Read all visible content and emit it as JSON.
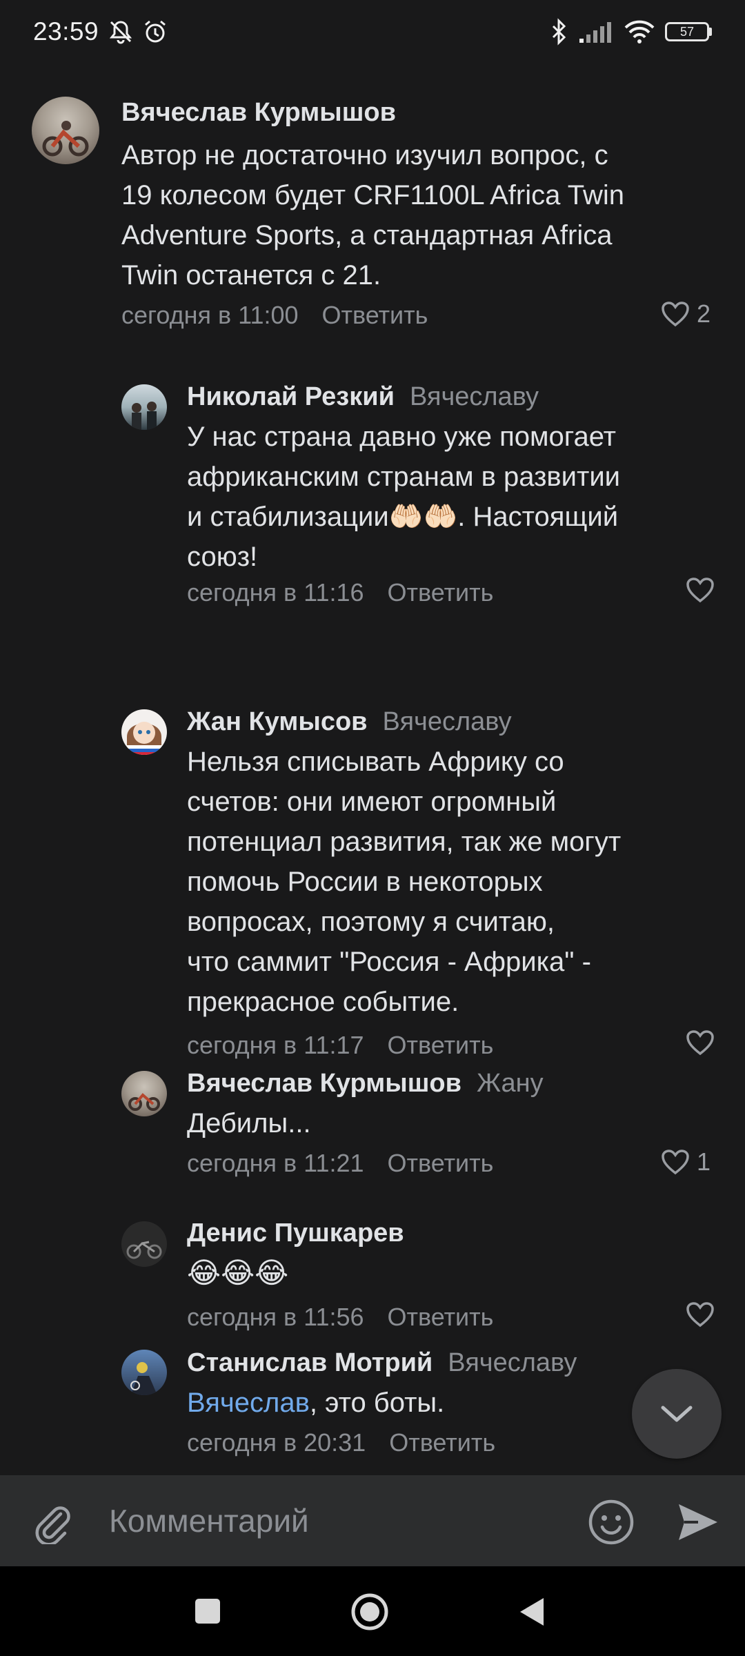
{
  "status_bar": {
    "time": "23:59",
    "battery": "57",
    "icons": [
      "mute-icon",
      "alarm-icon",
      "bluetooth-icon",
      "signal-icon",
      "wifi-icon",
      "battery-icon"
    ]
  },
  "comments": [
    {
      "author": "Вячеслав Курмышов",
      "reply_to": "",
      "text_lines": [
        "Автор не достаточно изучил вопрос, с",
        "19 колесом будет CRF1100L Africa Twin",
        "Adventure Sports, а стандартная Africa",
        "Twin останется с 21."
      ],
      "time": "сегодня в 11:00",
      "reply_label": "Ответить",
      "likes": "2"
    },
    {
      "author": "Николай Резкий",
      "reply_to": "Вячеславу",
      "text_lines": [
        "У нас страна давно уже помогает",
        "африканским странам в развитии",
        "и стабилизации🤲🏻🤲🏻. Настоящий",
        "союз!"
      ],
      "time": "сегодня в 11:16",
      "reply_label": "Ответить",
      "likes": ""
    },
    {
      "author": "Жан Кумысов",
      "reply_to": "Вячеславу",
      "text_lines": [
        "Нельзя списывать Африку со",
        "счетов: они имеют огромный",
        "потенциал развития, так же могут",
        "помочь России в некоторых",
        "вопросах, поэтому я считаю,",
        "что саммит \"Россия - Африка\" -",
        "прекрасное событие."
      ],
      "time": "сегодня в 11:17",
      "reply_label": "Ответить",
      "likes": ""
    },
    {
      "author": "Вячеслав Курмышов",
      "reply_to": "Жану",
      "text_lines": [
        "Дебилы..."
      ],
      "time": "сегодня в 11:21",
      "reply_label": "Ответить",
      "likes": "1"
    },
    {
      "author": "Денис Пушкарев",
      "reply_to": "",
      "text_lines": [
        "😂😂😂"
      ],
      "time": "сегодня в 11:56",
      "reply_label": "Ответить",
      "likes": ""
    },
    {
      "author": "Станислав Мотрий",
      "reply_to": "Вячеславу",
      "mention": "Вячеслав",
      "text_rest": ", это боты.",
      "time": "сегодня в 20:31",
      "reply_label": "Ответить",
      "likes": ""
    }
  ],
  "composer": {
    "placeholder": "Комментарий"
  },
  "colors": {
    "background": "#19191a",
    "composer": "#2c2d2e",
    "mention": "#71aaeb",
    "secondary_text": "#8c8f94"
  }
}
